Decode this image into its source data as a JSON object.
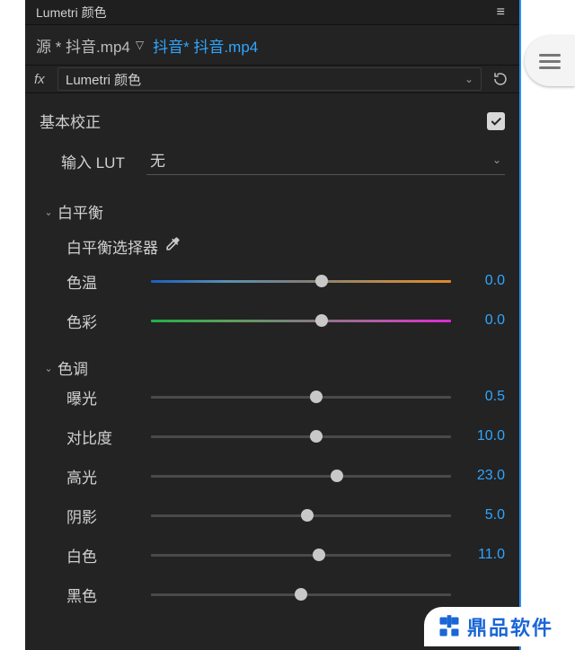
{
  "panel": {
    "title": "Lumetri 颜色",
    "source_prefix": "源 * 抖音.mp4",
    "clip_name": "抖音* 抖音.mp4",
    "fx_label": "fx",
    "effect_name": "Lumetri 颜色"
  },
  "basic": {
    "title": "基本校正",
    "lut_label": "输入 LUT",
    "lut_value": "无"
  },
  "wb": {
    "title": "白平衡",
    "picker": "白平衡选择器",
    "temp_label": "色温",
    "temp_value": "0.0",
    "tint_label": "色彩",
    "tint_value": "0.0"
  },
  "tone": {
    "title": "色调",
    "exposure_label": "曝光",
    "exposure_value": "0.5",
    "contrast_label": "对比度",
    "contrast_value": "10.0",
    "highlights_label": "高光",
    "highlights_value": "23.0",
    "shadows_label": "阴影",
    "shadows_value": "5.0",
    "whites_label": "白色",
    "whites_value": "11.0",
    "blacks_label": "黑色"
  },
  "brand": {
    "name": "鼎品软件"
  }
}
